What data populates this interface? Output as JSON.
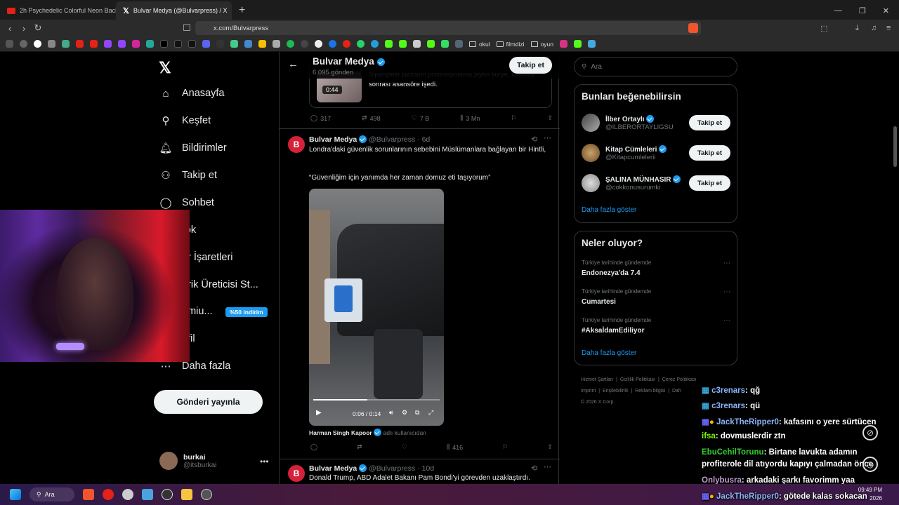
{
  "browser": {
    "tabs": [
      {
        "title": "2h Psychedelic Colorful Neon Backgr",
        "active": false
      },
      {
        "title": "Bulvar Medya (@Bulvarpress) / X",
        "active": true
      }
    ],
    "url": "x.com/Bulvarpress",
    "bookmark_folders": [
      "okul",
      "filmdizi",
      "oyun"
    ]
  },
  "sidebar": {
    "items": [
      {
        "label": "Anasayfa",
        "icon": "home-icon"
      },
      {
        "label": "Keşfet",
        "icon": "search-icon"
      },
      {
        "label": "Bildirimler",
        "icon": "bell-icon"
      },
      {
        "label": "Takip et",
        "icon": "follow-icon"
      },
      {
        "label": "Sohbet",
        "icon": "chat-icon"
      },
      {
        "label": "rok",
        "icon": "grok-icon"
      },
      {
        "label": "er İşaretleri",
        "icon": "bookmark-icon"
      },
      {
        "label": "erik Üreticisi St...",
        "icon": "creator-icon"
      },
      {
        "label": "emiu...",
        "icon": "premium-icon"
      },
      {
        "label": "ofil",
        "icon": "profile-icon"
      },
      {
        "label": "Daha fazla",
        "icon": "more-icon"
      }
    ],
    "discount_badge": "%50 indirim",
    "post_button": "Gönderi yayınla",
    "account": {
      "name": "burkai",
      "handle": "@itsburkai"
    }
  },
  "profile_header": {
    "name": "Bulvar Medya",
    "posts": "6.095 gönderi",
    "follow": "Takip et"
  },
  "tweets": [
    {
      "partial_text": "Siparişteki pizzanın promosyonunu yiyen kurye, teslimat sonrası asansöre işedi.",
      "video_time": "0:44",
      "stats": {
        "replies": "317",
        "retweets": "498",
        "likes": "7 B",
        "views": "3 Mn"
      }
    },
    {
      "name": "Bulvar Medya",
      "handle": "@Bulvarpress",
      "time": "· 6d",
      "text1": "Londra'daki güvenlik sorunlarının sebebini Müslümanlara bağlayan bir Hintli,",
      "text2": "“Güvenliğim için yanımda her zaman domuz eti taşıyorum”",
      "video_progress": "0:06 / 0:14",
      "attribution_name": "Harman Singh Kapoor",
      "attribution_note": "adlı kullanıcıdan",
      "stats": {
        "views": "416"
      }
    },
    {
      "name": "Bulvar Medya",
      "handle": "@Bulvarpress",
      "time": "· 10d",
      "text": "Donald Trump, ABD Adalet Bakanı Pam Bondi'yi görevden uzaklaştırdı."
    }
  ],
  "right": {
    "search_placeholder": "Ara",
    "suggest_title": "Bunları beğenebilirsin",
    "suggestions": [
      {
        "name": "İlber Ortaylı",
        "handle": "@ILBERORTAYLIGSU",
        "button": "Takip et"
      },
      {
        "name": "Kitap Cümleleri",
        "handle": "@Kitapcumlelerii",
        "button": "Takip et"
      },
      {
        "name": "ŞALINA MÜNHASIR",
        "handle": "@cokkonusurumki",
        "button": "Takip et"
      }
    ],
    "show_more": "Daha fazla göster",
    "trends_title": "Neler oluyor?",
    "trends": [
      {
        "context": "Türkiye tarihinde gündemde",
        "title": "Endonezya'da 7.4"
      },
      {
        "context": "Türkiye tarihinde gündemde",
        "title": "Cumartesi"
      },
      {
        "context": "Türkiye tarihinde gündemde",
        "title": "#AksaİdamEdiliyor"
      }
    ],
    "trends_more": "Daha fazla göster",
    "footer": [
      "Hizmet Şartları",
      "Gizlilik Politikası",
      "Çerez Politikası",
      "Imprint",
      "Erişilebilirlik",
      "Reklam bilgisi",
      "Dah",
      "© 2026 X Corp."
    ]
  },
  "chat": [
    {
      "user": "c3renars",
      "msg": ": qğ",
      "color": "#8ab4f8"
    },
    {
      "user": "c3renars",
      "msg": ": qü",
      "color": "#8ab4f8"
    },
    {
      "user": "JackTheRipper0",
      "msg": ": kafasını o yere sürtücen",
      "color": "#8ab4f8"
    },
    {
      "user": "ifsa",
      "msg": ": dovmuslerdir ztn",
      "color": "#7CFC00"
    },
    {
      "user": "EbuCehilTorunu",
      "msg": ": Birtane lavukta adamın",
      "color": "#32CD32"
    },
    {
      "user": "",
      "msg": "profiterole dil atıyordu kapıyı çalmadan önce",
      "color": "#fff"
    },
    {
      "user": "Onlybusra",
      "msg": ": arkadaki şarkı favorimm yaa",
      "color": "#c39bd3"
    },
    {
      "user": "JackTheRipper0",
      "msg": ": götede kalas sokacan",
      "color": "#8ab4f8"
    }
  ],
  "taskbar": {
    "search": "Ara",
    "time": "09:49 PM",
    "date": "2026"
  },
  "colors": {
    "accent": "#1d9bf0",
    "bg": "#000000",
    "text": "#e7e9ea",
    "muted": "#71767b"
  }
}
